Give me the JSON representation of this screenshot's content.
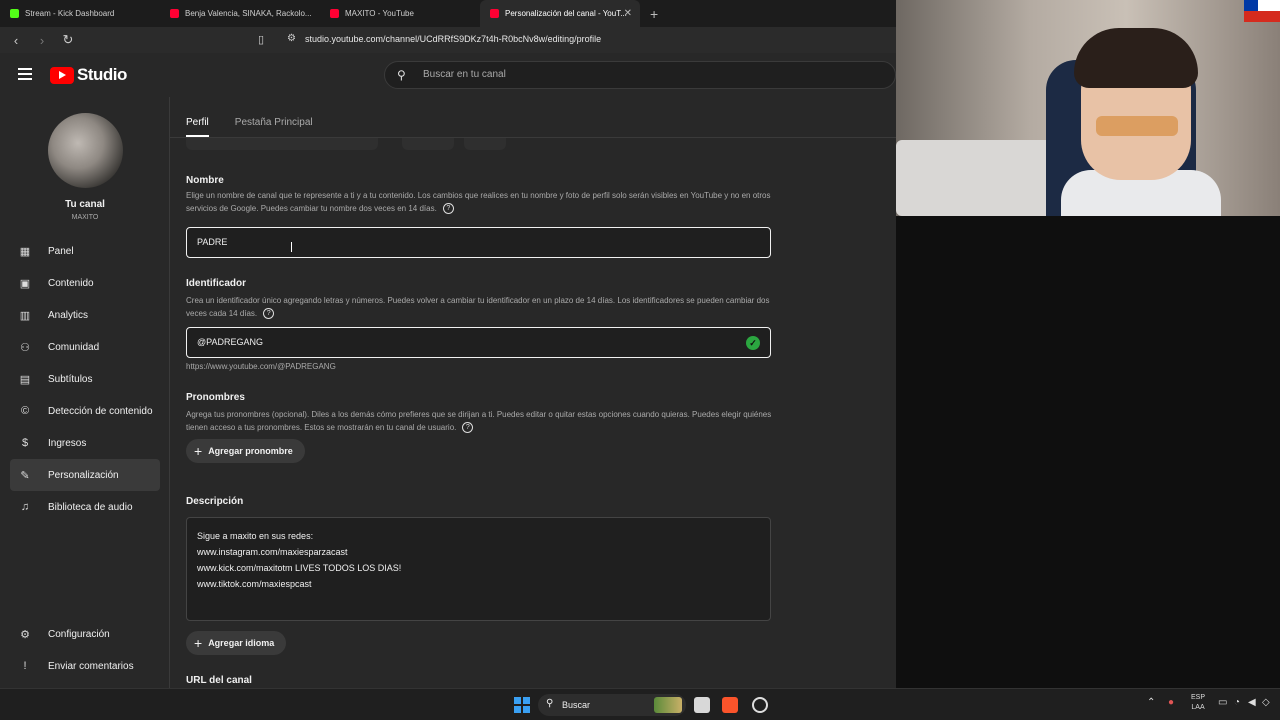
{
  "browser": {
    "tabs": [
      {
        "title": "Stream - Kick Dashboard",
        "color": "#53fc18"
      },
      {
        "title": "Benja Valencia, SINAKA, Rackolo...",
        "color": "#ff0033"
      },
      {
        "title": "MAXITO - YouTube",
        "color": "#ff0033"
      },
      {
        "title": "Personalización del canal - YouT...",
        "color": "#ff0033"
      }
    ],
    "url": "studio.youtube.com/channel/UCdRRfS9DKz7t4h-R0bcNv8w/editing/profile"
  },
  "header": {
    "logo_text": "Studio",
    "search_placeholder": "Buscar en tu canal"
  },
  "sidebar": {
    "channel_title": "Tu canal",
    "channel_subtitle": "MAXITO",
    "items": [
      {
        "label": "Panel",
        "icon": "dashboard-icon"
      },
      {
        "label": "Contenido",
        "icon": "content-icon"
      },
      {
        "label": "Analytics",
        "icon": "analytics-icon"
      },
      {
        "label": "Comunidad",
        "icon": "community-icon"
      },
      {
        "label": "Subtítulos",
        "icon": "subtitles-icon"
      },
      {
        "label": "Detección de contenido",
        "icon": "copyright-icon"
      },
      {
        "label": "Ingresos",
        "icon": "earn-icon"
      },
      {
        "label": "Personalización",
        "icon": "customization-icon"
      },
      {
        "label": "Biblioteca de audio",
        "icon": "audio-library-icon"
      }
    ],
    "bottom_items": [
      {
        "label": "Configuración",
        "icon": "gear-icon"
      },
      {
        "label": "Enviar comentarios",
        "icon": "feedback-icon"
      }
    ]
  },
  "main": {
    "tabs": [
      {
        "label": "Perfil"
      },
      {
        "label": "Pestaña Principal"
      }
    ],
    "name_section": {
      "title": "Nombre",
      "description": "Elige un nombre de canal que te represente a ti y a tu contenido. Los cambios que realices en tu nombre y foto de perfil solo serán visibles en YouTube y no en otros servicios de Google. Puedes cambiar tu nombre dos veces en 14 días.",
      "value": "PADRE"
    },
    "handle_section": {
      "title": "Identificador",
      "description": "Crea un identificador único agregando letras y números. Puedes volver a cambiar tu identificador en un plazo de 14 días. Los identificadores se pueden cambiar dos veces cada 14 días.",
      "value": "@PADREGANG",
      "hint": "https://www.youtube.com/@PADREGANG"
    },
    "pronouns_section": {
      "title": "Pronombres",
      "description": "Agrega tus pronombres (opcional). Diles a los demás cómo prefieres que se dirijan a ti. Puedes editar o quitar estas opciones cuando quieras. Puedes elegir quiénes tienen acceso a tus pronombres. Estos se mostrarán en tu canal de usuario.",
      "button": "Agregar pronombre"
    },
    "description_section": {
      "title": "Descripción",
      "lines": [
        "Sigue a maxito en sus redes:",
        "www.instagram.com/maxiesparzacast",
        "www.kick.com/maxitotm LIVES TODOS LOS DIAS!",
        "www.tiktok.com/maxiespcast"
      ],
      "add_language": "Agregar idioma"
    },
    "url_section": {
      "title": "URL del canal"
    }
  },
  "taskbar": {
    "search_label": "Buscar",
    "lang_top": "ESP",
    "lang_bottom": "LAA"
  }
}
